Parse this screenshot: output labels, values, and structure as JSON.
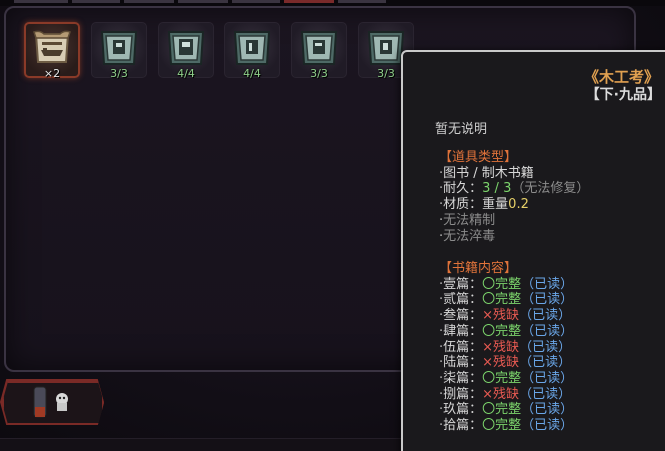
{
  "inventory": {
    "slots": [
      {
        "icon": "scroll-book-icon",
        "count": "×2",
        "selected": true
      },
      {
        "icon": "pawn-shop-book-icon",
        "count": "3/3",
        "selected": false
      },
      {
        "icon": "pawn-shop-book-icon",
        "count": "4/4",
        "selected": false
      },
      {
        "icon": "pawn-shop-book-icon",
        "count": "4/4",
        "selected": false
      },
      {
        "icon": "pawn-shop-book-icon",
        "count": "3/3",
        "selected": false
      },
      {
        "icon": "pawn-shop-book-icon",
        "count": "3/3",
        "selected": false
      }
    ]
  },
  "tooltip": {
    "title": "《木工考》",
    "grade": "【下·九品】",
    "description": "暂无说明",
    "item_type_header": "【道具类型】",
    "category": "图书 / 制木书籍",
    "durability_label": "耐久：",
    "durability_value": "3 / 3",
    "durability_note": "（无法修复）",
    "material_label": "材质：",
    "material_name": "重量",
    "material_value": "0.2",
    "no_refine": "无法精制",
    "no_poison": "无法淬毒",
    "contents_header": "【书籍内容】",
    "chapters": [
      {
        "name": "壹篇：",
        "status": "〇完整",
        "complete": true,
        "read": "（已读）"
      },
      {
        "name": "贰篇：",
        "status": "〇完整",
        "complete": true,
        "read": "（已读）"
      },
      {
        "name": "叁篇：",
        "status": "×残缺",
        "complete": false,
        "read": "（已读）"
      },
      {
        "name": "肆篇：",
        "status": "〇完整",
        "complete": true,
        "read": "（已读）"
      },
      {
        "name": "伍篇：",
        "status": "×残缺",
        "complete": false,
        "read": "（已读）"
      },
      {
        "name": "陆篇：",
        "status": "×残缺",
        "complete": false,
        "read": "（已读）"
      },
      {
        "name": "柒篇：",
        "status": "〇完整",
        "complete": true,
        "read": "（已读）"
      },
      {
        "name": "捌篇：",
        "status": "×残缺",
        "complete": false,
        "read": "（已读）"
      },
      {
        "name": "玖篇：",
        "status": "〇完整",
        "complete": true,
        "read": "（已读）"
      },
      {
        "name": "拾篇：",
        "status": "〇完整",
        "complete": true,
        "read": "（已读）"
      }
    ]
  },
  "colors": {
    "accent_orange": "#e0733a",
    "title_gold": "#e0a050",
    "status_green": "#7bd36b",
    "status_red": "#e85a52",
    "read_blue": "#6aa6e8",
    "selected_border": "#8a3a28"
  }
}
